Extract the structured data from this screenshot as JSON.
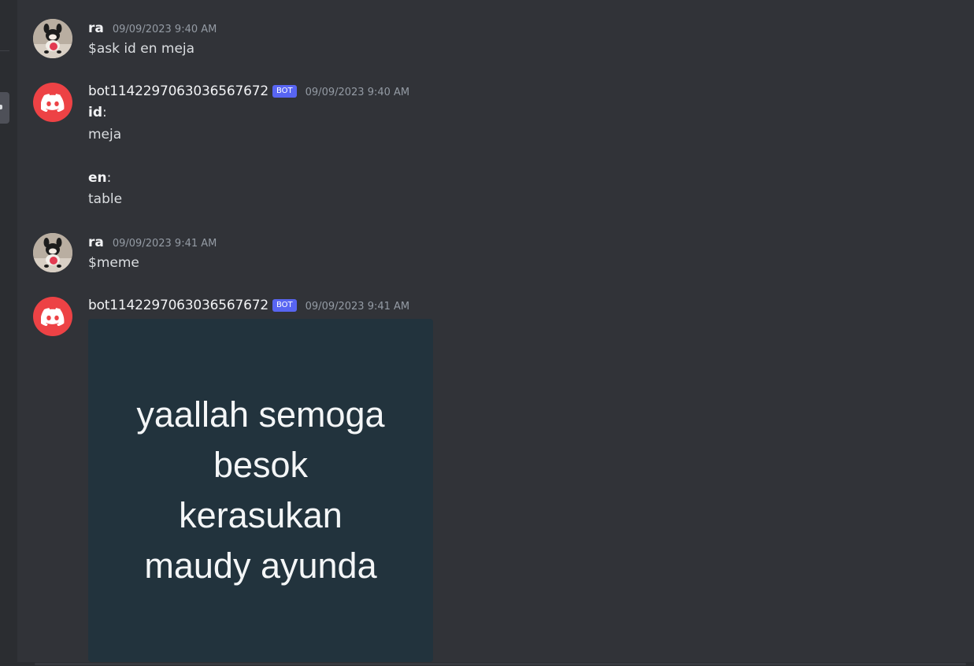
{
  "messages": [
    {
      "username": "ra",
      "timestamp": "09/09/2023 9:40 AM",
      "text": "$ask id en meja"
    },
    {
      "username": "bot1142297063036567672",
      "bot_tag": "BOT",
      "timestamp": "09/09/2023 9:40 AM",
      "fields": [
        {
          "label": "id",
          "value": "meja"
        },
        {
          "label": "en",
          "value": "table"
        }
      ]
    },
    {
      "username": "ra",
      "timestamp": "09/09/2023 9:41 AM",
      "text": "$meme"
    },
    {
      "username": "bot1142297063036567672",
      "bot_tag": "BOT",
      "timestamp": "09/09/2023 9:41 AM",
      "image_text_lines": [
        "yaallah semoga",
        "besok",
        "kerasukan",
        "maudy ayunda"
      ]
    }
  ],
  "colors": {
    "background": "#313338",
    "bot_tag": "#5865f2",
    "discord_avatar": "#ed4245",
    "meme_background": "#22333d"
  },
  "icons": {
    "user_avatar": "plush-toy-avatar",
    "bot_avatar": "discord-logo-icon"
  }
}
